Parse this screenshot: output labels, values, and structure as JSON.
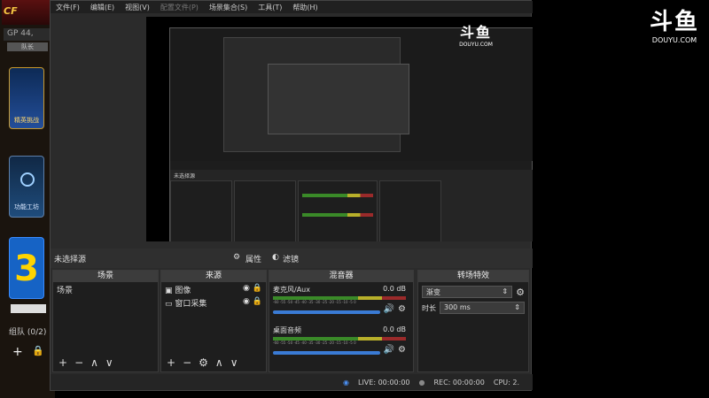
{
  "game": {
    "logo": "CF",
    "gp": "GP 44,",
    "rank_label": "队长",
    "cards": [
      {
        "label": "精英挑战",
        "color": "#1c4b8f"
      },
      {
        "label": "功能工坊",
        "color": "#1a3d6b"
      },
      {
        "label": "3",
        "color": "#1663c5"
      }
    ],
    "team": "组队 (0/2)"
  },
  "obs": {
    "menu": [
      "文件(F)",
      "编辑(E)",
      "视图(V)",
      "配置文件(P)",
      "场景集合(S)",
      "工具(T)",
      "帮助(H)"
    ],
    "menu_disabled_index": 3,
    "source_status": "未选择源",
    "properties_label": "属性",
    "filters_label": "滤镜",
    "docks": {
      "scenes": {
        "title": "场景",
        "items": [
          "场景"
        ]
      },
      "sources": {
        "title": "来源",
        "items": [
          "图像",
          "窗口采集"
        ]
      },
      "mixer": {
        "title": "混音器",
        "channels": [
          {
            "name": "麦克风/Aux",
            "db": "0.0 dB",
            "scale": "-60 -55 -50 -45 -40 -35 -30 -25 -20 -15 -10 -5 0"
          },
          {
            "name": "桌面音频",
            "db": "0.0 dB",
            "scale": "-60 -55 -50 -45 -40 -35 -30 -25 -20 -15 -10 -5 0"
          }
        ]
      },
      "transitions": {
        "title": "转场特效",
        "selected": "渐变",
        "duration_label": "时长",
        "duration_value": "300 ms"
      }
    },
    "status": {
      "live": "LIVE: 00:00:00",
      "rec": "REC: 00:00:00",
      "cpu": "CPU: 2."
    }
  },
  "watermark": {
    "brand": "斗鱼",
    "domain": "DOUYU.COM"
  },
  "nested_preview": {
    "brand": "斗鱼",
    "domain": "DOUYU.COM",
    "no_source": "未选择源"
  }
}
